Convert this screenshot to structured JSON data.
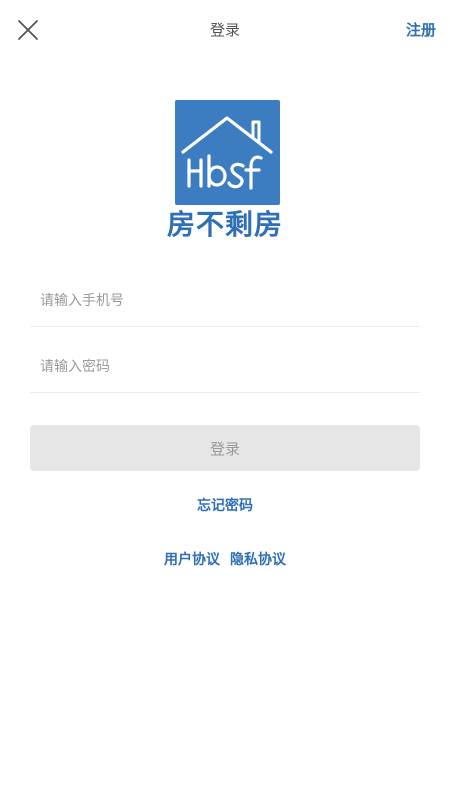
{
  "header": {
    "title": "登录",
    "register_label": "注册",
    "close_icon": "close-icon"
  },
  "logo": {
    "icon": "house-logo-icon",
    "brand_name": "房不剩房",
    "bg_color": "#3c7cc0"
  },
  "form": {
    "phone_placeholder": "请输入手机号",
    "phone_value": "",
    "password_placeholder": "请输入密码",
    "password_value": "",
    "login_label": "登录"
  },
  "links": {
    "forgot_password": "忘记密码",
    "user_agreement": "用户协议",
    "privacy_agreement": "隐私协议"
  },
  "colors": {
    "accent": "#2f6fb7",
    "button_disabled_bg": "#e6e6e6",
    "button_disabled_text": "#9a9a9a"
  }
}
